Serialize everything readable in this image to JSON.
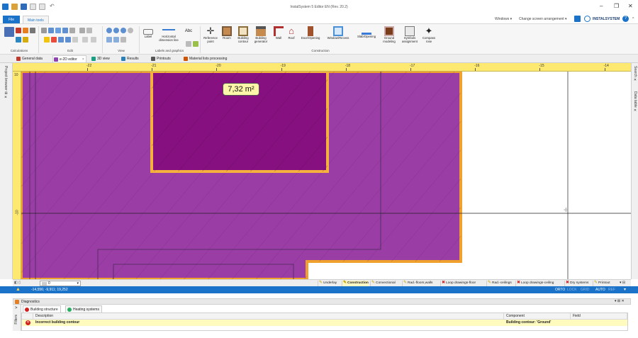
{
  "window": {
    "title": "InstalSystem 5 Editor EN (Rev. 20.2)",
    "windows_menu": "Windows",
    "arrangement_menu": "Change screen arrangement",
    "brand": "INSTALSYSTEM",
    "help_icon": "help-icon"
  },
  "ribbon_tabs": {
    "file": "File",
    "main": "Main tools"
  },
  "ribbon": {
    "groups": {
      "calculations": "Calculations",
      "edit": "Edit",
      "view": "View",
      "labels": "Labels and graphics",
      "construction": "Construction"
    },
    "buttons": {
      "label": "Label",
      "horizontal_dimension": "Horizontal dimension line",
      "abc": "Abc",
      "reference_point": "Reference point",
      "room": "Room",
      "building_contour": "Building contour",
      "building_generator": "Building generator",
      "wall": "Wall",
      "roof": "Roof",
      "door_opening": "Door/Opening",
      "window_recess": "Window/Recess",
      "slab_opening": "Slab/Opening",
      "ground_modeling": "Ground modeling",
      "symbols_assignment": "Symbols assignment",
      "compass_rose": "Compass rose"
    }
  },
  "doc_tabs": [
    {
      "label": "General data",
      "icon": "grid-icon",
      "color": "#c0392b"
    },
    {
      "label": "e-2D editor",
      "icon": "editor-icon",
      "color": "#8e44ad",
      "active": true
    },
    {
      "label": "3D view",
      "icon": "cube-icon",
      "color": "#16a085"
    },
    {
      "label": "Results",
      "icon": "results-icon",
      "color": "#2980b9"
    },
    {
      "label": "Printouts",
      "icon": "printer-icon",
      "color": "#555555"
    },
    {
      "label": "Material lists processing",
      "icon": "list-icon",
      "color": "#d35400"
    }
  ],
  "left_dock": {
    "project_browser": "Project browser"
  },
  "right_dock": {
    "search": "Search",
    "data_table": "Data table"
  },
  "rulers": {
    "top": [
      "-22",
      "-21",
      "-20",
      "-19",
      "-18",
      "-17",
      "-16",
      "-15",
      "-14"
    ],
    "left_top": "10",
    "left_mid": "-10"
  },
  "canvas": {
    "area_label": "7,32 m²",
    "colors": {
      "room_fill": "#9a3ea6",
      "selected_fill": "#86107f",
      "outline": "#f0a02c"
    }
  },
  "layer_selector": {
    "value": "0"
  },
  "layers": [
    {
      "label": "Underlay",
      "icon": "pencil-icon"
    },
    {
      "label": "Construction",
      "icon": "pencil-icon",
      "active": true
    },
    {
      "label": "Convectional",
      "icon": "pencil-icon"
    },
    {
      "label": "Rad.-floors,walls",
      "icon": "pencil-icon"
    },
    {
      "label": "Loop drawings-floor",
      "icon": "x-icon"
    },
    {
      "label": "Rad.-ceilings",
      "icon": "pencil-icon"
    },
    {
      "label": "Loop drawings-ceiling",
      "icon": "x-icon"
    },
    {
      "label": "Dry systems",
      "icon": "x-icon"
    },
    {
      "label": "Printout",
      "icon": "pencil-icon"
    }
  ],
  "status": {
    "coords": "-14,556; -9,911; 19,252",
    "ortho": "ORTO",
    "lock": "LOCK",
    "grid": "GRID",
    "auto": "AUTO",
    "ref": "REF"
  },
  "diagnostics": {
    "title": "Diagnostics",
    "side_label": "Filters",
    "tabs": [
      {
        "label": "Building structure",
        "icon": "error-icon"
      },
      {
        "label": "Heating systems",
        "icon": "ok-icon"
      }
    ],
    "columns": {
      "description": "Description",
      "component": "Component",
      "field": "Field"
    },
    "rows": [
      {
        "description": "Incorrect building contour",
        "component": "Building contour: 'Ground'",
        "field": ""
      }
    ]
  }
}
